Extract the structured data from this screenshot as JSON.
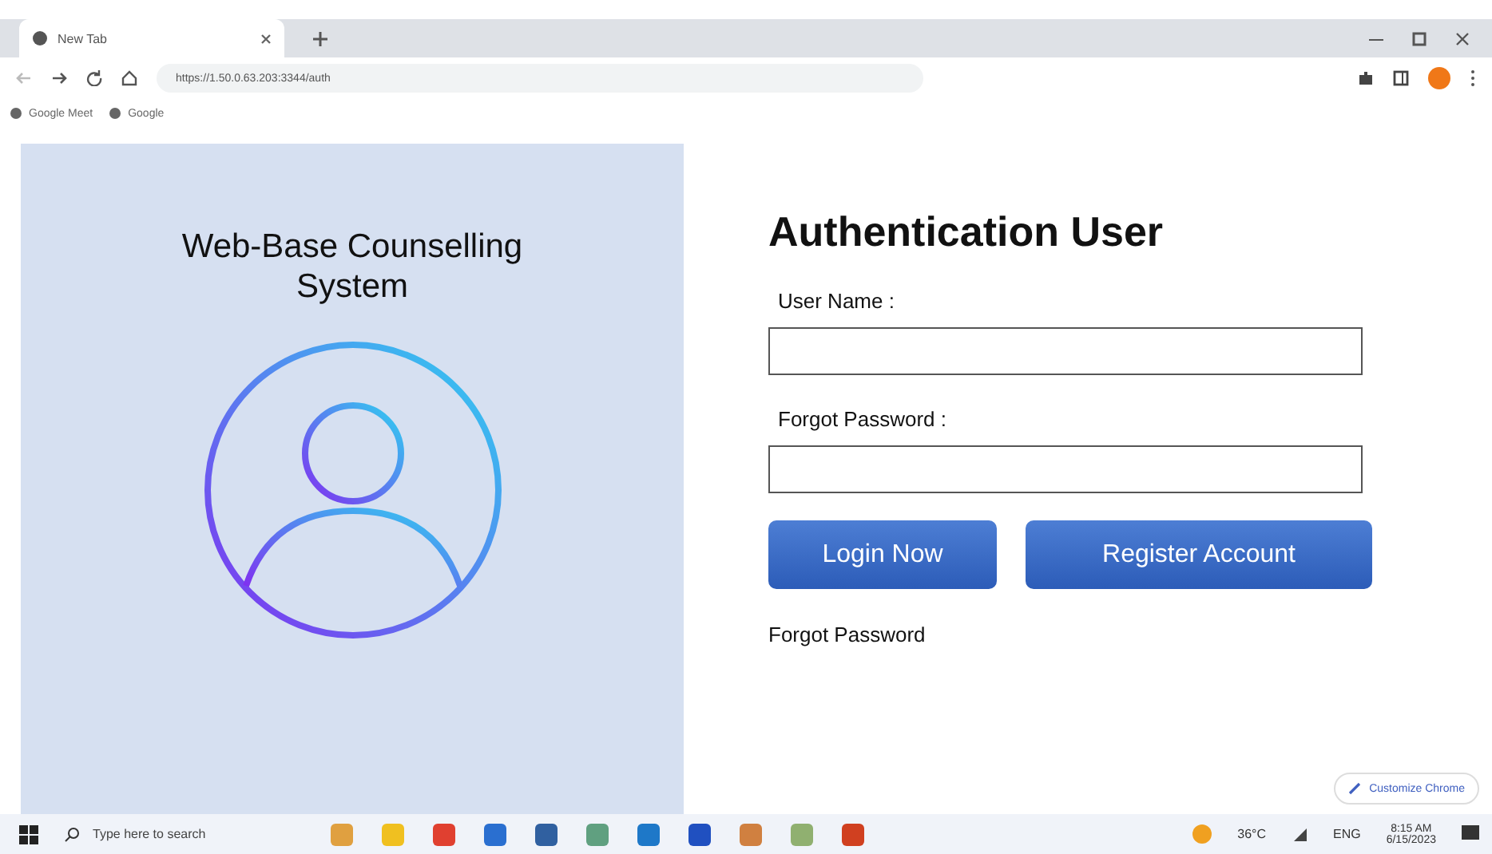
{
  "browser": {
    "tabs": [
      {
        "label": "New Tab",
        "selected": true
      }
    ],
    "url": "https://1.50.0.63.203:3344/auth",
    "bookmarks": [
      "Google Meet",
      "Google"
    ]
  },
  "left_panel": {
    "title": "Web-Base Counselling System"
  },
  "form": {
    "title": "Authentication User",
    "fields": [
      {
        "label": "User Name :"
      },
      {
        "label": "Forgot Password :"
      }
    ],
    "buttons": [
      "Login Now",
      "Register Account"
    ],
    "link": "Forgot Password"
  },
  "customize_button": "Customize Chrome",
  "taskbar": {
    "search_placeholder": "Type here to search",
    "temperature": "36°C",
    "language": "ENG",
    "time": "8:15 AM",
    "date": "6/15/2023"
  }
}
